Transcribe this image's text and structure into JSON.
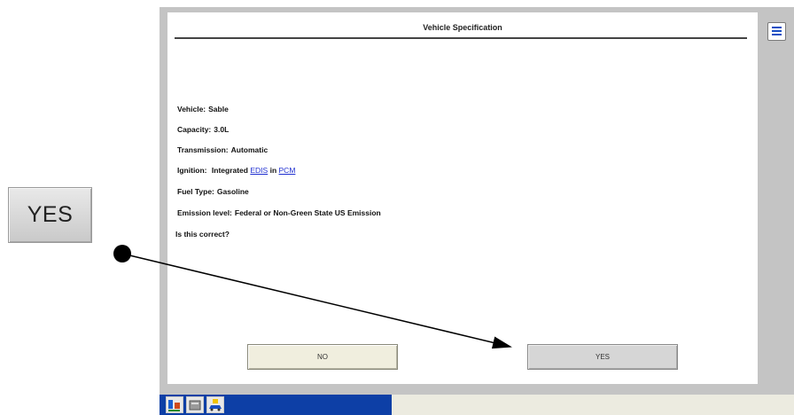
{
  "callout": {
    "yes_label": "YES"
  },
  "dialog": {
    "title": "Vehicle Specification",
    "vehicle": {
      "label": "Vehicle:",
      "value": "Sable"
    },
    "capacity": {
      "label": "Capacity:",
      "value": "3.0L"
    },
    "transmission": {
      "label": "Transmission:",
      "value": "Automatic"
    },
    "ignition": {
      "label": "Ignition:",
      "prefix": "Integrated",
      "link1": "EDIS",
      "middle": "in",
      "link2": "PCM"
    },
    "fuel_type": {
      "label": "Fuel Type:",
      "value": "Gasoline"
    },
    "emission": {
      "label": "Emission level:",
      "value": "Federal or Non-Green State US Emission"
    },
    "question": "Is this correct?",
    "no_button": "NO",
    "yes_button": "YES"
  },
  "icons": {
    "menu": "list-menu-icon",
    "taskbar": [
      "vehicle-diagnostic-icon",
      "toolbox-icon",
      "car-service-icon"
    ]
  },
  "colors": {
    "link": "#1f2fd0",
    "taskbar_blue": "#0d3fa6",
    "frame_gray": "#c4c4c4"
  }
}
